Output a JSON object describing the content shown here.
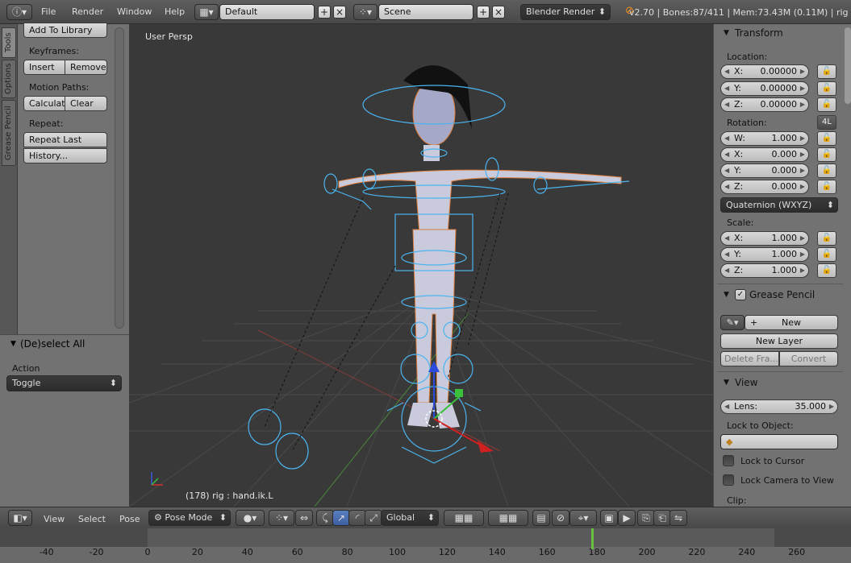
{
  "topbar": {
    "menus": [
      "File",
      "Render",
      "Window",
      "Help"
    ],
    "layout": "Default",
    "scene": "Scene",
    "engine": "Blender Render",
    "status": "v2.70 | Bones:87/411 | Mem:73.43M (0.11M) | rig"
  },
  "left_tabs": [
    "Tools",
    "Options",
    "Grease Pencil"
  ],
  "tools": {
    "add_to_library": "Add To Library",
    "keyframes_label": "Keyframes:",
    "insert": "Insert",
    "remove": "Remove",
    "motion_paths_label": "Motion Paths:",
    "calculate": "Calculat",
    "clear": "Clear",
    "repeat_label": "Repeat:",
    "repeat_last": "Repeat Last",
    "history": "History..."
  },
  "operator": {
    "title": "(De)select All",
    "action_label": "Action",
    "action_value": "Toggle"
  },
  "viewport": {
    "view_label": "User Persp",
    "object_info": "(178) rig : hand.ik.L"
  },
  "transform": {
    "title": "Transform",
    "location_label": "Location:",
    "location": [
      {
        "k": "X:",
        "v": "0.00000"
      },
      {
        "k": "Y:",
        "v": "0.00000"
      },
      {
        "k": "Z:",
        "v": "0.00000"
      }
    ],
    "rotation_label": "Rotation:",
    "rotation_mode_btn": "4L",
    "rotation": [
      {
        "k": "W:",
        "v": "1.000"
      },
      {
        "k": "X:",
        "v": "0.000"
      },
      {
        "k": "Y:",
        "v": "0.000"
      },
      {
        "k": "Z:",
        "v": "0.000"
      }
    ],
    "rotation_mode": "Quaternion (WXYZ)",
    "scale_label": "Scale:",
    "scale": [
      {
        "k": "X:",
        "v": "1.000"
      },
      {
        "k": "Y:",
        "v": "1.000"
      },
      {
        "k": "Z:",
        "v": "1.000"
      }
    ]
  },
  "grease_pencil": {
    "title": "Grease Pencil",
    "new": "New",
    "new_layer": "New Layer",
    "delete_frame": "Delete Fra...",
    "convert": "Convert"
  },
  "view": {
    "title": "View",
    "lens_label": "Lens:",
    "lens_value": "35.000",
    "lock_object_label": "Lock to Object:",
    "lock_cursor": "Lock to Cursor",
    "lock_camera": "Lock Camera to View",
    "clip_label": "Clip:"
  },
  "bottombar": {
    "menus": [
      "View",
      "Select",
      "Pose"
    ],
    "mode": "Pose Mode",
    "orientation": "Global"
  },
  "timeline": {
    "ticks": [
      "-40",
      "-20",
      "0",
      "20",
      "40",
      "60",
      "80",
      "100",
      "120",
      "140",
      "160",
      "180",
      "200",
      "220",
      "240",
      "260"
    ],
    "current_frame": 178
  }
}
